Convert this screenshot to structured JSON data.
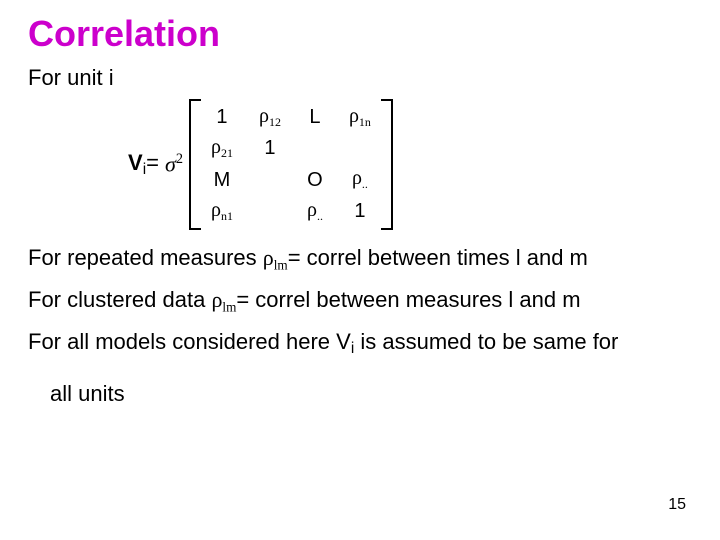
{
  "title": "Correlation",
  "unit_line": "For unit i",
  "eq": {
    "lhs": "V",
    "lhs_sub": "i",
    "equals": "=",
    "sigma": "σ",
    "sigma_sup": "2"
  },
  "matrix": {
    "r1c1": "1",
    "r1c2_rho": "ρ",
    "r1c2_sub": "12",
    "r1c3": "L",
    "r1c4_rho": "ρ",
    "r1c4_sub": "1n",
    "r2c1_rho": "ρ",
    "r2c1_sub": "21",
    "r2c2": "1",
    "r2c3": "",
    "r2c4": "",
    "r3c1": "M",
    "r3c2": "",
    "r3c3": "O",
    "r3c4_rho": "ρ",
    "r3c4_sub": "..",
    "r4c1_rho": "ρ",
    "r4c1_sub": "n1",
    "r4c2": "",
    "r4c3_rho": "ρ",
    "r4c3_sub": "..",
    "r4c4": "1"
  },
  "rep_measures_a": "For repeated measures ",
  "rep_measures_rho": "ρ",
  "rep_measures_sub": "lm",
  "rep_measures_b": "= correl between times l and m",
  "clustered_a": "For clustered data ",
  "clustered_rho": "ρ",
  "clustered_sub": "lm",
  "clustered_b": "= correl between measures l and m",
  "all_models_a": "For all models considered here V",
  "all_models_sub": "i",
  "all_models_b": " is assumed to be same for",
  "all_models_c": "all units",
  "page_num": "15"
}
